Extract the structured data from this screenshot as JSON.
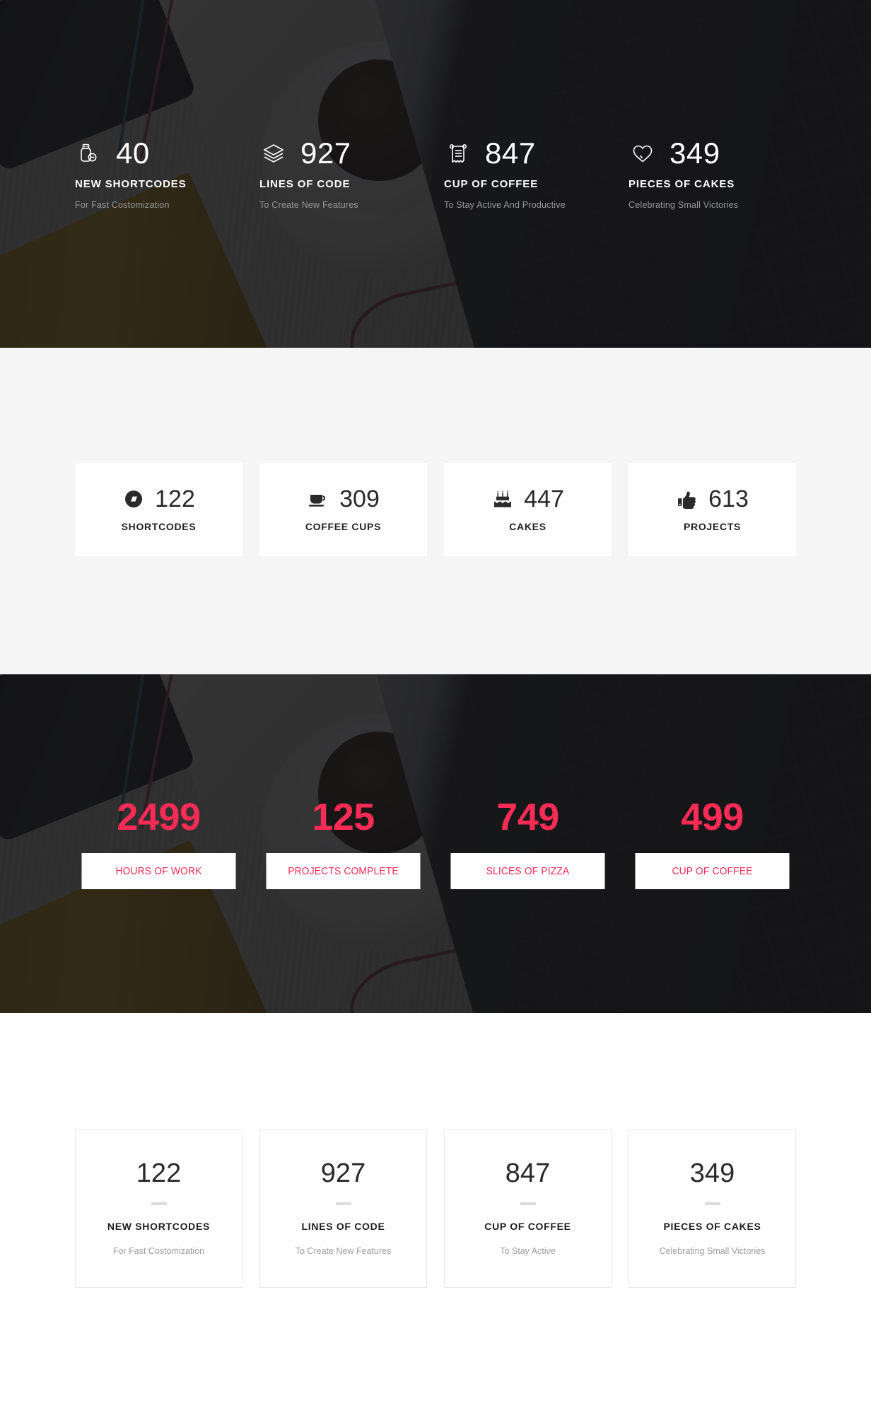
{
  "theme": {
    "accent_pink": "#fa2b55",
    "section2_bg": "#f5f5f5",
    "card_bg": "#ffffff",
    "dark_overlay": "rgba(20,20,22,0.86)",
    "muted_text": "#9a9a9a"
  },
  "hero": {
    "items": [
      {
        "icon": "usb-drive-icon",
        "number": "40",
        "label": "NEW SHORTCODES",
        "sub": "For Fast Costomization"
      },
      {
        "icon": "layers-icon",
        "number": "927",
        "label": "LINES OF CODE",
        "sub": "To Create New Features"
      },
      {
        "icon": "receipt-icon",
        "number": "847",
        "label": "CUP OF COFFEE",
        "sub": "To Stay Active And Productive"
      },
      {
        "icon": "heart-icon",
        "number": "349",
        "label": "PIECES OF CAKES",
        "sub": "Celebrating Small Victories"
      }
    ]
  },
  "cards": {
    "items": [
      {
        "icon": "code-badge-icon",
        "number": "122",
        "label": "SHORTCODES"
      },
      {
        "icon": "coffee-cup-icon",
        "number": "309",
        "label": "COFFEE CUPS"
      },
      {
        "icon": "birthday-cake-icon",
        "number": "447",
        "label": "CAKES"
      },
      {
        "icon": "thumbs-up-icon",
        "number": "613",
        "label": "PROJECTS"
      }
    ]
  },
  "pink": {
    "items": [
      {
        "number": "2499",
        "label": "HOURS OF WORK"
      },
      {
        "number": "125",
        "label": "PROJECTS COMPLETE"
      },
      {
        "number": "749",
        "label": "SLICES OF PIZZA"
      },
      {
        "number": "499",
        "label": "CUP OF COFFEE"
      }
    ]
  },
  "boxes": {
    "items": [
      {
        "number": "122",
        "label": "NEW SHORTCODES",
        "sub": "For Fast Costomization"
      },
      {
        "number": "927",
        "label": "LINES OF CODE",
        "sub": "To Create New Features"
      },
      {
        "number": "847",
        "label": "CUP OF COFFEE",
        "sub": "To Stay Active"
      },
      {
        "number": "349",
        "label": "PIECES OF CAKES",
        "sub": "Celebrating Small Victories"
      }
    ]
  }
}
